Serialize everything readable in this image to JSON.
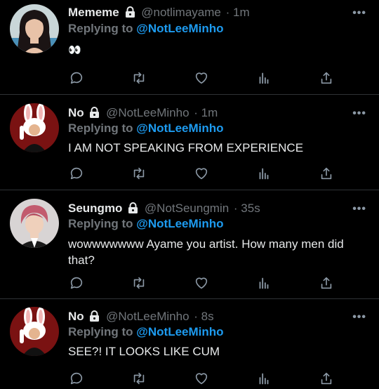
{
  "tweets": [
    {
      "name": "Mememe",
      "handle": "@notlimayame",
      "time": "· 1m",
      "replying_label": "Replying to",
      "replying_to": "@NotLeeMinho",
      "text": "👀",
      "avatar": "woman-photo-avatar",
      "locked": true
    },
    {
      "name": "No",
      "handle": "@NotLeeMinho",
      "time": "· 1m",
      "replying_label": "Replying to",
      "replying_to": "@NotLeeMinho",
      "text": "I AM NOT SPEAKING FROM EXPERIENCE",
      "avatar": "bunny-costume-avatar",
      "locked": true
    },
    {
      "name": "Seungmo",
      "handle": "@NotSeungmin",
      "time": "· 35s",
      "replying_label": "Replying to",
      "replying_to": "@NotLeeMinho",
      "text": "wowwwwwww Ayame you artist. How many men did that?",
      "avatar": "man-photo-avatar",
      "locked": true
    },
    {
      "name": "No",
      "handle": "@NotLeeMinho",
      "time": "· 8s",
      "replying_label": "Replying to",
      "replying_to": "@NotLeeMinho",
      "text": "SEE?! IT LOOKS LIKE CUM",
      "avatar": "bunny-costume-avatar",
      "locked": true
    }
  ],
  "more_label": "•••",
  "colors": {
    "background": "#000000",
    "link": "#1d9bf0",
    "muted": "#71767b",
    "text": "#e7e9ea"
  }
}
